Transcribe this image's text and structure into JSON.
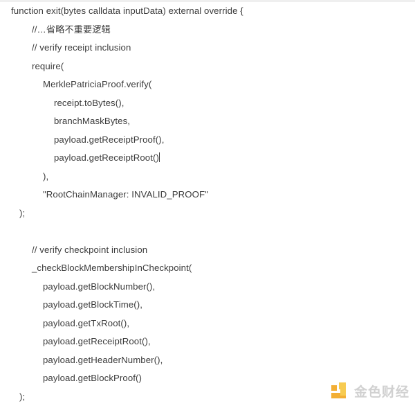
{
  "page": {
    "background_color": "#ffffff",
    "text_color": "#3b3b3b",
    "top_band_color": "#efefef"
  },
  "code": {
    "language": "Solidity",
    "lines": [
      {
        "indent": "ind-0",
        "text": "function exit(bytes calldata inputData) external override {"
      },
      {
        "indent": "ind-1",
        "text": "//…省略不重要逻辑"
      },
      {
        "indent": "ind-1",
        "text": "// verify receipt inclusion"
      },
      {
        "indent": "ind-1",
        "text": "require("
      },
      {
        "indent": "ind-2",
        "text": "MerklePatriciaProof.verify("
      },
      {
        "indent": "ind-3",
        "text": "receipt.toBytes(),"
      },
      {
        "indent": "ind-3",
        "text": "branchMaskBytes,"
      },
      {
        "indent": "ind-3",
        "text": "payload.getReceiptProof(),"
      },
      {
        "indent": "ind-3",
        "text": "payload.getReceiptRoot()",
        "caret": true
      },
      {
        "indent": "ind-2",
        "text": "),"
      },
      {
        "indent": "ind-2",
        "text": "\"RootChainManager: INVALID_PROOF\""
      },
      {
        "indent": "ind-h",
        "text": ");"
      },
      {
        "indent": "ind-0",
        "text": ""
      },
      {
        "indent": "ind-1",
        "text": "// verify checkpoint inclusion"
      },
      {
        "indent": "ind-1",
        "text": "_checkBlockMembershipInCheckpoint("
      },
      {
        "indent": "ind-2",
        "text": "payload.getBlockNumber(),"
      },
      {
        "indent": "ind-2",
        "text": "payload.getBlockTime(),"
      },
      {
        "indent": "ind-2",
        "text": "payload.getTxRoot(),"
      },
      {
        "indent": "ind-2",
        "text": "payload.getReceiptRoot(),"
      },
      {
        "indent": "ind-2",
        "text": "payload.getHeaderNumber(),"
      },
      {
        "indent": "ind-2",
        "text": "payload.getBlockProof()"
      },
      {
        "indent": "ind-h",
        "text": ");"
      }
    ]
  },
  "watermark": {
    "brand_text": "金色财经",
    "logo_color_primary": "#f3ab2b",
    "logo_color_secondary": "#f7c948",
    "text_color": "#cfcfcf"
  }
}
